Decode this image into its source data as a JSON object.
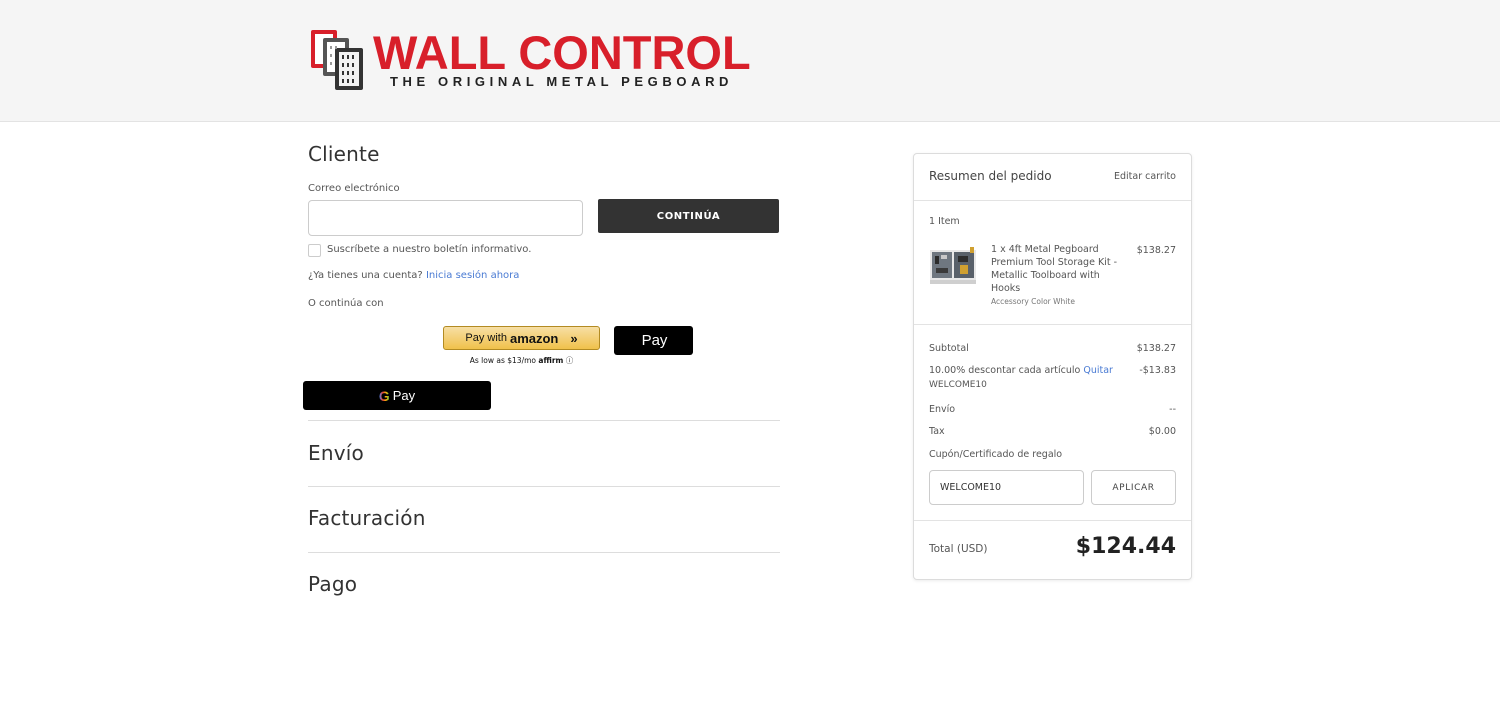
{
  "brand": {
    "name": "WALL CONTROL",
    "tagline": "THE ORIGINAL METAL PEGBOARD",
    "color": "#d81f2a"
  },
  "customer": {
    "title": "Cliente",
    "email_label": "Correo electrónico",
    "email_value": "",
    "continue_label": "CONTINÚA",
    "newsletter_label": "Suscríbete a nuestro boletín informativo.",
    "account_prompt": "¿Ya tienes una cuenta?",
    "signin_link": "Inicia sesión ahora",
    "or_continue": "O continúa con"
  },
  "payments": {
    "amazon_prefix": "Pay with",
    "amazon_brand": "amazon",
    "amazon_chevron": "»",
    "affirm_text": "As low as $13/mo",
    "affirm_brand": "affirm",
    "affirm_info": "ⓘ",
    "apple_icon": "",
    "apple_text": "Pay",
    "google_icon": "G",
    "google_text": "Pay"
  },
  "sections": {
    "shipping": "Envío",
    "billing": "Facturación",
    "payment": "Pago"
  },
  "summary": {
    "title": "Resumen del pedido",
    "edit_cart": "Editar carrito",
    "item_count": "1 Item",
    "item": {
      "name": "1 x 4ft Metal Pegboard Premium Tool Storage Kit - Metallic Toolboard with Hooks",
      "option": "Accessory Color White",
      "price": "$138.27"
    },
    "subtotal_label": "Subtotal",
    "subtotal_value": "$138.27",
    "discount_label": "10.00% descontar cada artículo",
    "discount_remove": "Quitar",
    "discount_code": "WELCOME10",
    "discount_value": "-$13.83",
    "shipping_label": "Envío",
    "shipping_value": "--",
    "tax_label": "Tax",
    "tax_value": "$0.00",
    "coupon_link": "Cupón/Certificado de regalo",
    "coupon_value": "WELCOME10",
    "apply_label": "APLICAR",
    "total_label": "Total (USD)",
    "total_value": "$124.44"
  }
}
